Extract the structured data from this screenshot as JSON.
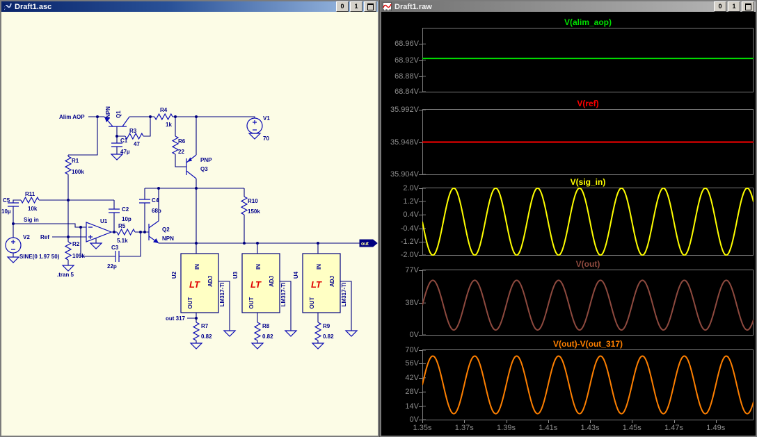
{
  "left_window": {
    "title": "Draft1.asc",
    "controls": {
      "btn0": "0",
      "btn1": "1"
    },
    "schematic": {
      "power_label": "Alim AOP",
      "sig_label": "Sig in",
      "ref_label": "Ref",
      "out317_label": "out 317",
      "out_port": "out",
      "directive": ".tran 5",
      "reg_pins": {
        "in": "IN",
        "out": "OUT",
        "adj": "ADJ"
      },
      "logo": "LT",
      "parts": {
        "q1": {
          "ref": "Q1",
          "val": "NPN"
        },
        "q2": {
          "ref": "Q2",
          "val": "NPN"
        },
        "q3": {
          "ref": "Q3",
          "val": "PNP"
        },
        "r1": {
          "ref": "R1",
          "val": "100k"
        },
        "r2": {
          "ref": "R2",
          "val": "109k"
        },
        "r3": {
          "ref": "R3",
          "val": "47"
        },
        "r4": {
          "ref": "R4",
          "val": "1k"
        },
        "r5": {
          "ref": "R5",
          "val": "5.1k"
        },
        "r6": {
          "ref": "R6",
          "val": "22"
        },
        "r7": {
          "ref": "R7",
          "val": "0.82"
        },
        "r8": {
          "ref": "R8",
          "val": "0.82"
        },
        "r9": {
          "ref": "R9",
          "val": "0.82"
        },
        "r10": {
          "ref": "R10",
          "val": "150k"
        },
        "r11": {
          "ref": "R11",
          "val": "10k"
        },
        "c1": {
          "ref": "C1",
          "val": "47µ"
        },
        "c2": {
          "ref": "C2",
          "val": "10p"
        },
        "c3": {
          "ref": "C3",
          "val": "22p"
        },
        "c4": {
          "ref": "C4",
          "val": "68p"
        },
        "c5": {
          "ref": "C5",
          "val": "10µ"
        },
        "v1": {
          "ref": "V1",
          "val": "70"
        },
        "v2": {
          "ref": "V2",
          "val": "SINE(0 1.97 50)"
        },
        "u1": {
          "ref": "U1"
        },
        "u2": {
          "ref": "U2",
          "val": "LM317-TI"
        },
        "u3": {
          "ref": "U3",
          "val": "LM317-TI"
        },
        "u4": {
          "ref": "U4",
          "val": "LM317-TI"
        }
      }
    }
  },
  "right_window": {
    "title": "Draft1.raw",
    "controls": {
      "btn0": "0",
      "btn1": "1"
    }
  },
  "colors": {
    "schematic_bg": "#fcfce6",
    "schematic_ink": "#000080",
    "logo_red": "#e00000",
    "plot_axis_text": "#8f8f8f",
    "plot_border": "#7d7d7d",
    "active_title": "#0a246a"
  },
  "chart_data": {
    "type": "line",
    "x": {
      "unit": "s",
      "range": [
        1.35,
        1.508
      ],
      "tick_values": [
        1.35,
        1.37,
        1.39,
        1.41,
        1.43,
        1.45,
        1.47,
        1.49
      ],
      "tick_labels": [
        "1.35s",
        "1.37s",
        "1.39s",
        "1.41s",
        "1.43s",
        "1.45s",
        "1.47s",
        "1.49s"
      ]
    },
    "plots": [
      {
        "title": "V(alim_aop)",
        "color": "#00e000",
        "ylim": [
          68.84,
          69.0
        ],
        "yticks": [
          {
            "label": "68.96V",
            "value": 68.96
          },
          {
            "label": "68.92V",
            "value": 68.92
          },
          {
            "label": "68.88V",
            "value": 68.88
          },
          {
            "label": "68.84V",
            "value": 68.84
          }
        ],
        "signal": {
          "kind": "dc",
          "value": 68.924
        }
      },
      {
        "title": "V(ref)",
        "color": "#ff0000",
        "ylim": [
          35.904,
          35.992
        ],
        "yticks": [
          {
            "label": "35.992V",
            "value": 35.992
          },
          {
            "label": "35.948V",
            "value": 35.948
          },
          {
            "label": "35.904V",
            "value": 35.904
          }
        ],
        "signal": {
          "kind": "dc",
          "value": 35.948
        }
      },
      {
        "title": "V(sig_in)",
        "color": "#ffff00",
        "ylim": [
          -2.0,
          2.0
        ],
        "yticks": [
          {
            "label": "2.0V",
            "value": 2.0
          },
          {
            "label": "1.2V",
            "value": 1.2
          },
          {
            "label": "0.4V",
            "value": 0.4
          },
          {
            "label": "-0.4V",
            "value": -0.4
          },
          {
            "label": "-1.2V",
            "value": -1.2
          },
          {
            "label": "-2.0V",
            "value": -2.0
          }
        ],
        "signal": {
          "kind": "sine",
          "center": 0,
          "amplitude": 1.97,
          "freq_hz": 50,
          "phase_deg": 180
        }
      },
      {
        "title": "V(out)",
        "color": "#8f4a3f",
        "ylim": [
          0,
          77
        ],
        "yticks": [
          {
            "label": "77V",
            "value": 77
          },
          {
            "label": "38V",
            "value": 38
          },
          {
            "label": "0V",
            "value": 0
          }
        ],
        "signal": {
          "kind": "sine",
          "center": 35.5,
          "amplitude": 29,
          "freq_hz": 50,
          "phase_deg": 0
        }
      },
      {
        "title": "V(out)-V(out_317)",
        "color": "#ff8000",
        "ylim": [
          0,
          70
        ],
        "yticks": [
          {
            "label": "70V",
            "value": 70
          },
          {
            "label": "56V",
            "value": 56
          },
          {
            "label": "42V",
            "value": 42
          },
          {
            "label": "28V",
            "value": 28
          },
          {
            "label": "14V",
            "value": 14
          },
          {
            "label": "0V",
            "value": 0
          }
        ],
        "signal": {
          "kind": "sine",
          "center": 35,
          "amplitude": 28.5,
          "freq_hz": 50,
          "phase_deg": 0
        }
      }
    ]
  }
}
